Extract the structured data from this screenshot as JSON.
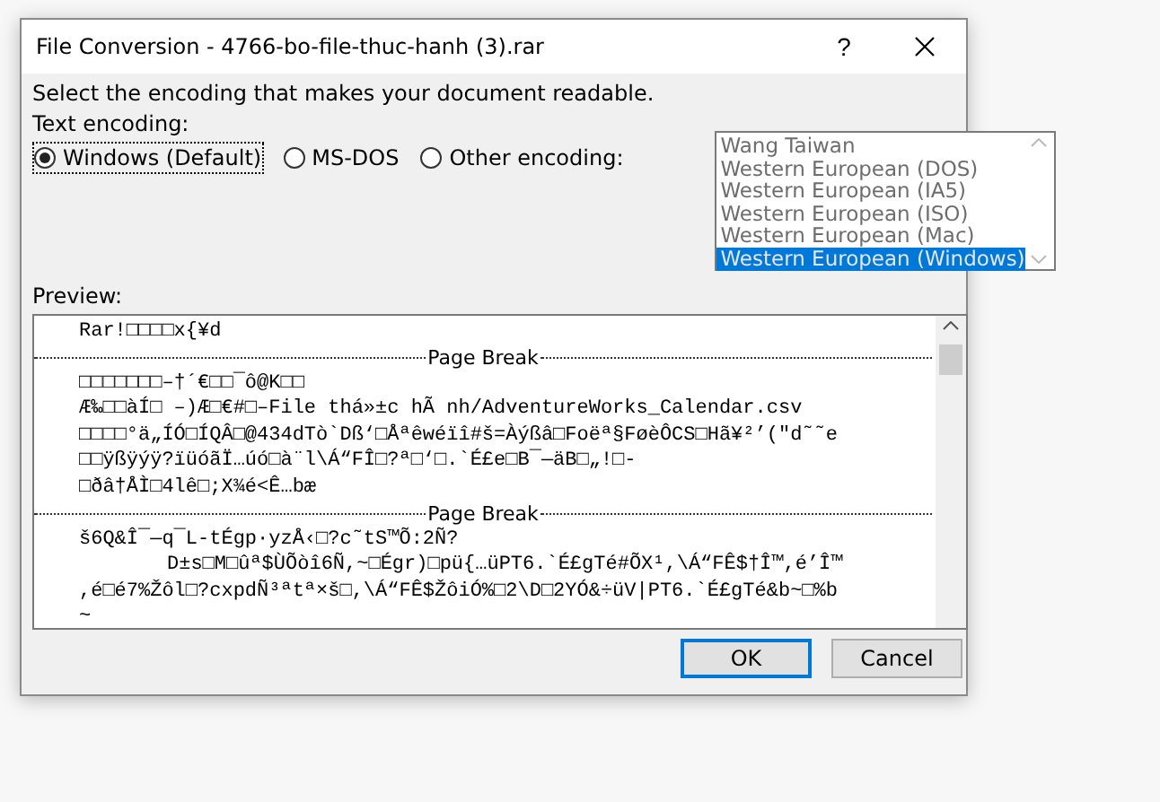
{
  "window": {
    "title": "File Conversion - 4766-bo-file-thuc-hanh (3).rar",
    "help": "?"
  },
  "instruction": "Select the encoding that makes your document readable.",
  "encoding_label": "Text encoding:",
  "radios": [
    {
      "label": "Windows (Default)",
      "selected": true
    },
    {
      "label": "MS-DOS",
      "selected": false
    },
    {
      "label": "Other encoding:",
      "selected": false
    }
  ],
  "encoding_list": {
    "disabled": true,
    "items": [
      {
        "label": "Wang Taiwan",
        "selected": false
      },
      {
        "label": "Western European (DOS)",
        "selected": false
      },
      {
        "label": "Western European (IA5)",
        "selected": false
      },
      {
        "label": "Western European (ISO)",
        "selected": false
      },
      {
        "label": "Western European (Mac)",
        "selected": false
      },
      {
        "label": "Western European (Windows)",
        "selected": true
      }
    ]
  },
  "preview": {
    "label": "Preview:",
    "lines": [
      {
        "kind": "line",
        "text": "Rar!□□□□x{¥d"
      },
      {
        "kind": "page_break",
        "text": "Page Break"
      },
      {
        "kind": "line",
        "text": "□□□□□□□–†´€□□¯ô@K□□"
      },
      {
        "kind": "line",
        "text": "Æ‰□□àÍ□ –)Æ□€#□–File thá»±c hÃ nh/AdventureWorks_Calendar.csv"
      },
      {
        "kind": "line",
        "text": "□□□□°ä„ÍÓ□ÍQÂ□@434dTò`Dß‘□Åªêwéïî#š=Àýßâ□Foëª§FøèÔCS□Hã¥²’(\"d˜˜e"
      },
      {
        "kind": "line",
        "text": "□□ÿßÿýÿ?ïüóãÏ…úó□à¨l\\Á“FÎ□?ª□‘□.`É£e□B¯—äB□„!□-"
      },
      {
        "kind": "line",
        "text": "□ðâ†ÅÌ□4lê□;X¾é<Ê…bæ"
      },
      {
        "kind": "page_break",
        "text": "Page Break"
      },
      {
        "kind": "line",
        "text": "š6Q&Î¯—q¯L-tÉgp·yzÅ‹□?c˜tS™Õ:2Ñ?"
      },
      {
        "kind": "indented",
        "text": "D±s□M□ûª$ÙÕòî6Ñ,~□Égr)□pü{…üPT6.`É£gTé#ÕX¹,\\Á“FÊ$†Î™,é’Î™"
      },
      {
        "kind": "line",
        "text": ",é□é7%Žôl□?cxpdÑ³ªtª×š□,\\Á“FÊ$ŽôiÓ%□2\\D□2YÓ&÷üV|PT6.`É£gTé&b~□%b"
      },
      {
        "kind": "line",
        "text": "~"
      }
    ]
  },
  "buttons": [
    {
      "label": "OK",
      "default": true
    },
    {
      "label": "Cancel",
      "default": false
    }
  ]
}
